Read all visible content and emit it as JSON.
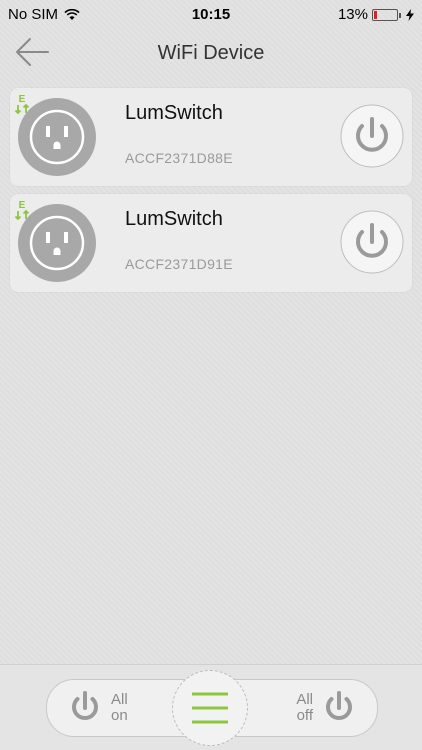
{
  "status_bar": {
    "carrier": "No SIM",
    "time": "10:15",
    "battery_percent": "13%",
    "battery_level": 0.13,
    "battery_color": "#e02020"
  },
  "header": {
    "back_icon": "arrow-left-icon",
    "title": "WiFi Device"
  },
  "devices": [
    {
      "name": "LumSwitch",
      "id": "ACCF2371D88E",
      "badge": "E",
      "power_state": "off"
    },
    {
      "name": "LumSwitch",
      "id": "ACCF2371D91E",
      "badge": "E",
      "power_state": "off"
    }
  ],
  "bottom_bar": {
    "all_on_line1": "All",
    "all_on_line2": "on",
    "all_off_line1": "All",
    "all_off_line2": "off",
    "menu_icon": "menu-icon"
  },
  "colors": {
    "accent_green": "#8cc63f",
    "icon_gray": "#9a9a9a"
  }
}
